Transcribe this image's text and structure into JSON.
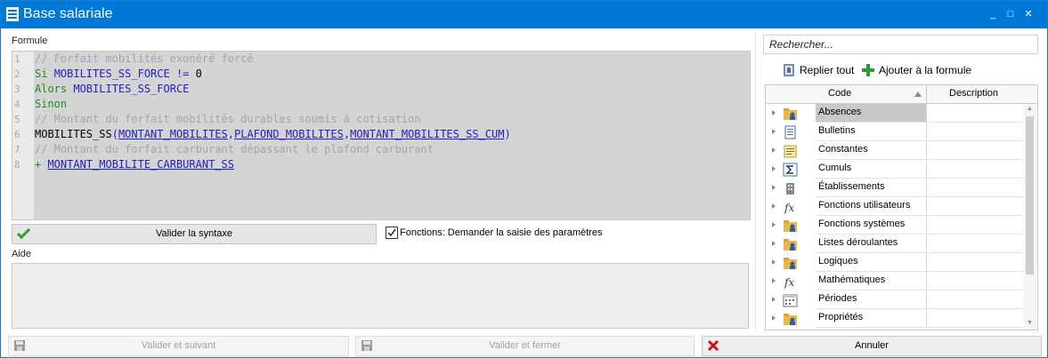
{
  "window": {
    "title": "Base salariale",
    "controls": {
      "minimize": "_",
      "maximize": "□",
      "close": "✕"
    }
  },
  "formula": {
    "label": "Formule",
    "line_numbers": [
      "1",
      "2",
      "3",
      "4",
      "5",
      "6",
      "7",
      "8"
    ],
    "lines": [
      {
        "parts": [
          {
            "t": "// Forfait mobilités exonéré forcé",
            "c": "cmt"
          }
        ]
      },
      {
        "parts": [
          {
            "t": "Si ",
            "c": "kw"
          },
          {
            "t": "MOBILITES_SS_FORCE",
            "c": "id"
          },
          {
            "t": " != ",
            "c": "id"
          },
          {
            "t": "0",
            "c": "num"
          }
        ]
      },
      {
        "parts": [
          {
            "t": "Alors ",
            "c": "kw"
          },
          {
            "t": "MOBILITES_SS_FORCE",
            "c": "id"
          }
        ]
      },
      {
        "parts": [
          {
            "t": "Sinon",
            "c": "kw"
          }
        ]
      },
      {
        "parts": [
          {
            "t": "// Montant du forfait mobilités durables soumis à cotisation",
            "c": "cmt"
          }
        ]
      },
      {
        "parts": [
          {
            "t": "MOBILITES_SS",
            "c": "fn"
          },
          {
            "t": "(",
            "c": "id"
          },
          {
            "t": "MONTANT_MOBILITES",
            "c": "lnk"
          },
          {
            "t": ",",
            "c": "id"
          },
          {
            "t": "PLAFOND_MOBILITES",
            "c": "lnk"
          },
          {
            "t": ",",
            "c": "id"
          },
          {
            "t": "MONTANT_MOBILITES_SS_CUM",
            "c": "lnk"
          },
          {
            "t": ")",
            "c": "id"
          }
        ]
      },
      {
        "parts": [
          {
            "t": "// Montant du forfait carburant dépassant le plafond carburant",
            "c": "cmt"
          }
        ]
      },
      {
        "parts": [
          {
            "t": "+ ",
            "c": "kw"
          },
          {
            "t": "MONTANT_MOBILITE_CARBURANT_SS",
            "c": "lnk"
          }
        ]
      }
    ]
  },
  "syntax_button": {
    "label": "Valider la syntaxe",
    "icon": "check-icon"
  },
  "functions_checkbox": {
    "label": "Fonctions: Demander la saisie des paramètres",
    "checked": true
  },
  "aide": {
    "label": "Aide"
  },
  "footer": {
    "next": {
      "label": "Valider et suivant",
      "icon": "save-icon",
      "enabled": false
    },
    "close": {
      "label": "Valider et fermer",
      "icon": "save-icon",
      "enabled": false
    },
    "cancel": {
      "label": "Annuler",
      "icon": "x-icon",
      "enabled": true
    }
  },
  "panel": {
    "search_placeholder": "Rechercher...",
    "collapse_all": "Replier tout",
    "add_to_formula": "Ajouter à la formule",
    "columns": {
      "code": "Code",
      "description": "Description"
    },
    "rows": [
      {
        "label": "Absences",
        "icon": "folder-person-icon",
        "selected": true
      },
      {
        "label": "Bulletins",
        "icon": "document-icon"
      },
      {
        "label": "Constantes",
        "icon": "notepad-icon"
      },
      {
        "label": "Cumuls",
        "icon": "sigma-icon"
      },
      {
        "label": "Établissements",
        "icon": "building-icon"
      },
      {
        "label": "Fonctions utilisateurs",
        "icon": "fx-icon"
      },
      {
        "label": "Fonctions systèmes",
        "icon": "folder-person-icon"
      },
      {
        "label": "Listes déroulantes",
        "icon": "folder-person-icon"
      },
      {
        "label": "Logiques",
        "icon": "folder-person-icon"
      },
      {
        "label": "Mathématiques",
        "icon": "fx-icon"
      },
      {
        "label": "Périodes",
        "icon": "calendar-icon"
      },
      {
        "label": "Propriétés",
        "icon": "folder-person-icon"
      }
    ]
  },
  "colors": {
    "titlebar": "#0078d7",
    "keyword": "#1f8a1f",
    "identifier": "#2020c0",
    "comment": "#a5a5a5",
    "cancel_x": "#d01010"
  }
}
